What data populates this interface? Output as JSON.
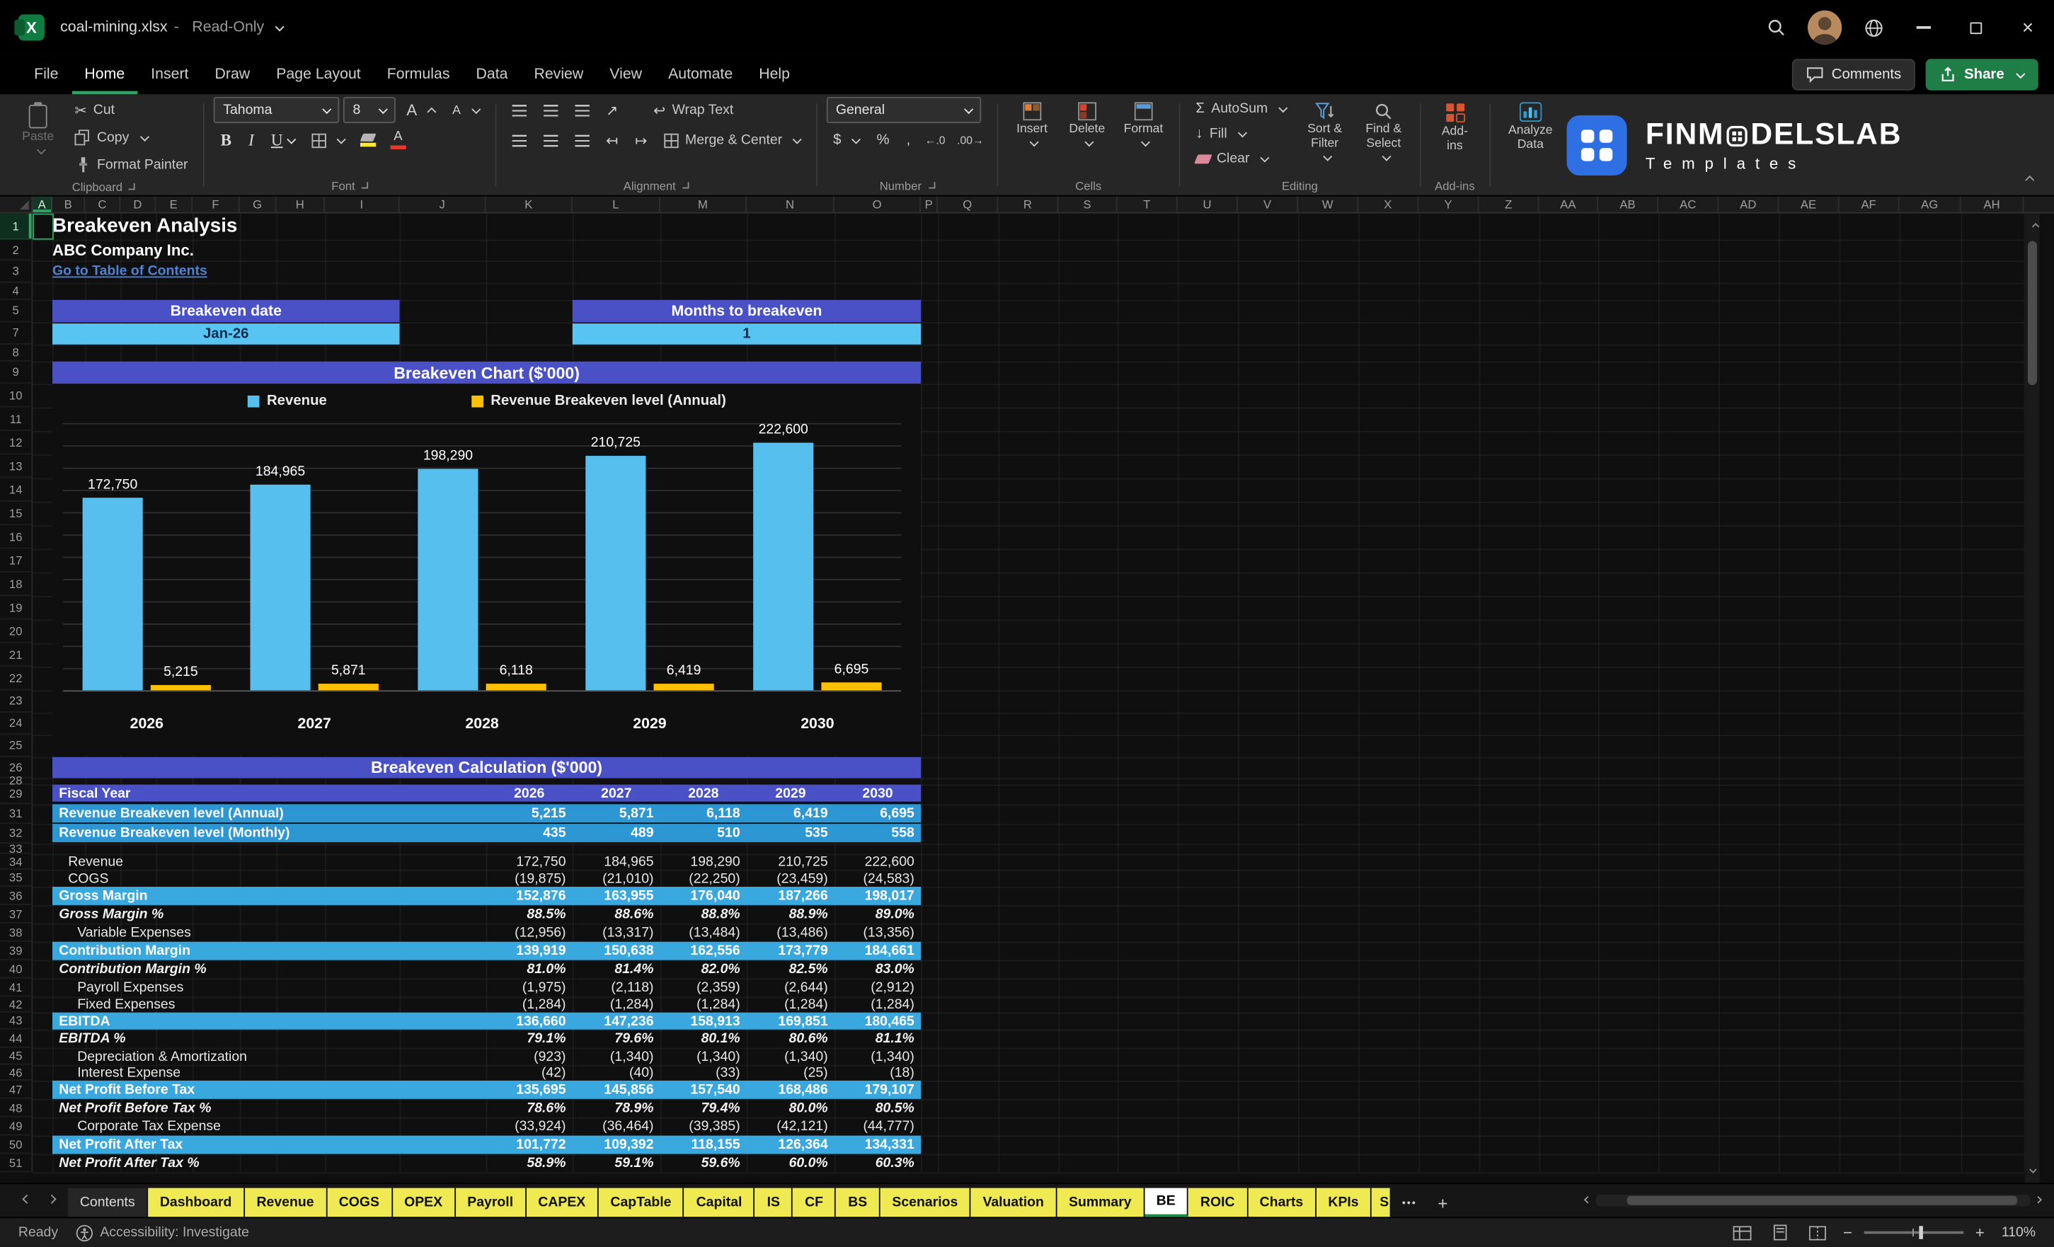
{
  "titlebar": {
    "app_icon_letter": "X",
    "file_name": "coal-mining.xlsx",
    "separator": "-",
    "mode": "Read-Only"
  },
  "menu": {
    "items": [
      "File",
      "Home",
      "Insert",
      "Draw",
      "Page Layout",
      "Formulas",
      "Data",
      "Review",
      "View",
      "Automate",
      "Help"
    ],
    "active": "Home",
    "comments_label": "Comments",
    "share_label": "Share"
  },
  "ribbon": {
    "clipboard": {
      "group": "Clipboard",
      "paste": "Paste",
      "cut": "Cut",
      "copy": "Copy",
      "format_painter": "Format Painter"
    },
    "font": {
      "group": "Font",
      "name_value": "Tahoma",
      "size_value": "8"
    },
    "alignment": {
      "group": "Alignment",
      "wrap": "Wrap Text",
      "merge": "Merge & Center"
    },
    "number": {
      "group": "Number",
      "format_value": "General"
    },
    "cells": {
      "group": "Cells",
      "insert": "Insert",
      "delete": "Delete",
      "format": "Format"
    },
    "editing": {
      "group": "Editing",
      "autosum": "AutoSum",
      "fill": "Fill",
      "clear": "Clear",
      "sort": "Sort & Filter",
      "find": "Find & Select"
    },
    "addins": {
      "group": "Add-ins",
      "button_label": "Add-ins",
      "analyze_label": "Analyze Data"
    },
    "glyphs": {
      "cut": "✂",
      "bold": "B",
      "italic": "I",
      "underline": "U",
      "font_grow": "A",
      "font_shrink": "A",
      "orientation": "↗",
      "indent_dec": "↤",
      "indent_inc": "↦",
      "wrap_arrow": "↩",
      "autosum": "Σ",
      "fill_arrow": "↓",
      "dollar": "$",
      "percent": "%",
      "comma": ",",
      "dec_increase": "←.0",
      "dec_decrease": ".00→",
      "more_tabs": "•••",
      "plus": "+"
    }
  },
  "brand": {
    "name": "FINMODELSLAB",
    "subtitle": "Templates"
  },
  "sheet": {
    "columns": [
      "A",
      "B",
      "C",
      "D",
      "E",
      "F",
      "G",
      "H",
      "I",
      "J",
      "K",
      "L",
      "M",
      "N",
      "O",
      "P",
      "Q",
      "R",
      "S",
      "T",
      "U",
      "V",
      "W",
      "X",
      "Y",
      "Z",
      "AA",
      "AB",
      "AC",
      "AD",
      "AE",
      "AF",
      "AG",
      "AH"
    ],
    "rows": [
      1,
      2,
      3,
      4,
      5,
      7,
      8,
      9,
      10,
      11,
      12,
      13,
      14,
      15,
      16,
      17,
      18,
      19,
      20,
      21,
      22,
      23,
      24,
      25,
      26,
      28,
      29,
      31,
      32,
      33,
      34,
      35,
      36,
      37,
      38,
      39,
      40,
      41,
      42,
      43,
      44,
      45,
      46,
      47,
      48,
      49,
      50,
      51
    ],
    "title": "Breakeven Analysis",
    "subtitle": "ABC Company Inc.",
    "link": "Go to Table of Contents",
    "breakeven_date": {
      "label": "Breakeven date",
      "value": "Jan-26"
    },
    "months_to_breakeven": {
      "label": "Months to breakeven",
      "value": "1"
    },
    "chart_title": "Breakeven Chart ($'000)",
    "calc_title": "Breakeven Calculation ($'000)"
  },
  "chart_data": {
    "type": "bar",
    "title": "Breakeven Chart ($'000)",
    "categories": [
      "2026",
      "2027",
      "2028",
      "2029",
      "2030"
    ],
    "series": [
      {
        "name": "Revenue",
        "color": "#56BFEE",
        "values": [
          172750,
          184965,
          198290,
          210725,
          222600
        ],
        "labels": [
          "172,750",
          "184,965",
          "198,290",
          "210,725",
          "222,600"
        ]
      },
      {
        "name": "Revenue Breakeven level (Annual)",
        "color": "#FFC000",
        "values": [
          5215,
          5871,
          6118,
          6419,
          6695
        ],
        "labels": [
          "5,215",
          "5,871",
          "6,118",
          "6,419",
          "6,695"
        ]
      }
    ],
    "ylim": [
      0,
      240000
    ],
    "grid_step": 20000,
    "grid": true,
    "legend_position": "top"
  },
  "calc_table": {
    "header": {
      "label": "Fiscal Year",
      "years": [
        "2026",
        "2027",
        "2028",
        "2029",
        "2030"
      ]
    },
    "rows": [
      {
        "label": "Revenue Breakeven level (Annual)",
        "values": [
          "5,215",
          "5,871",
          "6,118",
          "6,419",
          "6,695"
        ],
        "style": "highlight"
      },
      {
        "label": "Revenue Breakeven level (Monthly)",
        "values": [
          "435",
          "489",
          "510",
          "535",
          "558"
        ],
        "style": "highlight"
      },
      {
        "style": "gap"
      },
      {
        "label": "Revenue",
        "values": [
          "172,750",
          "184,965",
          "198,290",
          "210,725",
          "222,600"
        ],
        "style": "plain",
        "indent": 1
      },
      {
        "label": "COGS",
        "values": [
          "(19,875)",
          "(21,010)",
          "(22,250)",
          "(23,459)",
          "(24,583)"
        ],
        "style": "plain",
        "indent": 1
      },
      {
        "label": "Gross Margin",
        "values": [
          "152,876",
          "163,955",
          "176,040",
          "187,266",
          "198,017"
        ],
        "style": "subtotal"
      },
      {
        "label": "Gross Margin %",
        "values": [
          "88.5%",
          "88.6%",
          "88.8%",
          "88.9%",
          "89.0%"
        ],
        "style": "pct"
      },
      {
        "label": "Variable Expenses",
        "values": [
          "(12,956)",
          "(13,317)",
          "(13,484)",
          "(13,486)",
          "(13,356)"
        ],
        "style": "plain",
        "indent": 2
      },
      {
        "label": "Contribution Margin",
        "values": [
          "139,919",
          "150,638",
          "162,556",
          "173,779",
          "184,661"
        ],
        "style": "subtotal"
      },
      {
        "label": "Contribution Margin %",
        "values": [
          "81.0%",
          "81.4%",
          "82.0%",
          "82.5%",
          "83.0%"
        ],
        "style": "pct"
      },
      {
        "label": "Payroll Expenses",
        "values": [
          "(1,975)",
          "(2,118)",
          "(2,359)",
          "(2,644)",
          "(2,912)"
        ],
        "style": "plain",
        "indent": 2
      },
      {
        "label": "Fixed Expenses",
        "values": [
          "(1,284)",
          "(1,284)",
          "(1,284)",
          "(1,284)",
          "(1,284)"
        ],
        "style": "plain",
        "indent": 2
      },
      {
        "label": "EBITDA",
        "values": [
          "136,660",
          "147,236",
          "158,913",
          "169,851",
          "180,465"
        ],
        "style": "subtotal"
      },
      {
        "label": "EBITDA %",
        "values": [
          "79.1%",
          "79.6%",
          "80.1%",
          "80.6%",
          "81.1%"
        ],
        "style": "pct"
      },
      {
        "label": "Depreciation & Amortization",
        "values": [
          "(923)",
          "(1,340)",
          "(1,340)",
          "(1,340)",
          "(1,340)"
        ],
        "style": "plain",
        "indent": 2
      },
      {
        "label": "Interest Expense",
        "values": [
          "(42)",
          "(40)",
          "(33)",
          "(25)",
          "(18)"
        ],
        "style": "plain",
        "indent": 2
      },
      {
        "label": "Net Profit Before Tax",
        "values": [
          "135,695",
          "145,856",
          "157,540",
          "168,486",
          "179,107"
        ],
        "style": "subtotal"
      },
      {
        "label": "Net Profit Before Tax %",
        "values": [
          "78.6%",
          "78.9%",
          "79.4%",
          "80.0%",
          "80.5%"
        ],
        "style": "pct"
      },
      {
        "label": "Corporate Tax Expense",
        "values": [
          "(33,924)",
          "(36,464)",
          "(39,385)",
          "(42,121)",
          "(44,777)"
        ],
        "style": "plain",
        "indent": 2
      },
      {
        "label": "Net Profit After Tax",
        "values": [
          "101,772",
          "109,392",
          "118,155",
          "126,364",
          "134,331"
        ],
        "style": "subtotal"
      },
      {
        "label": "Net Profit After Tax %",
        "values": [
          "58.9%",
          "59.1%",
          "59.6%",
          "60.0%",
          "60.3%"
        ],
        "style": "pct"
      }
    ]
  },
  "tabs": {
    "items": [
      {
        "label": "Contents",
        "style": "default"
      },
      {
        "label": "Dashboard",
        "style": "yellow"
      },
      {
        "label": "Revenue",
        "style": "yellow"
      },
      {
        "label": "COGS",
        "style": "yellow"
      },
      {
        "label": "OPEX",
        "style": "yellow"
      },
      {
        "label": "Payroll",
        "style": "yellow"
      },
      {
        "label": "CAPEX",
        "style": "yellow"
      },
      {
        "label": "CapTable",
        "style": "yellow"
      },
      {
        "label": "Capital",
        "style": "yellow"
      },
      {
        "label": "IS",
        "style": "yellow"
      },
      {
        "label": "CF",
        "style": "yellow"
      },
      {
        "label": "BS",
        "style": "yellow"
      },
      {
        "label": "Scenarios",
        "style": "yellow"
      },
      {
        "label": "Valuation",
        "style": "yellow"
      },
      {
        "label": "Summary",
        "style": "yellow"
      },
      {
        "label": "BE",
        "style": "active"
      },
      {
        "label": "ROIC",
        "style": "yellow"
      },
      {
        "label": "Charts",
        "style": "yellow"
      },
      {
        "label": "KPIs",
        "style": "yellow"
      },
      {
        "label": "S",
        "style": "yellow-partial"
      }
    ]
  },
  "statusbar": {
    "ready": "Ready",
    "accessibility": "Accessibility: Investigate",
    "zoom_out": "−",
    "zoom_in": "+",
    "zoom_level": "110%"
  },
  "colors": {
    "header_purple": "#4A51C6",
    "value_lightblue": "#57C4F1",
    "highlight_blue": "#2D97D3",
    "subtotal_cyan": "#38A8DE",
    "chart_blue": "#56BFEE",
    "chart_yellow": "#FFC000",
    "tab_yellow": "#EFE952",
    "excel_green": "#107C41"
  }
}
